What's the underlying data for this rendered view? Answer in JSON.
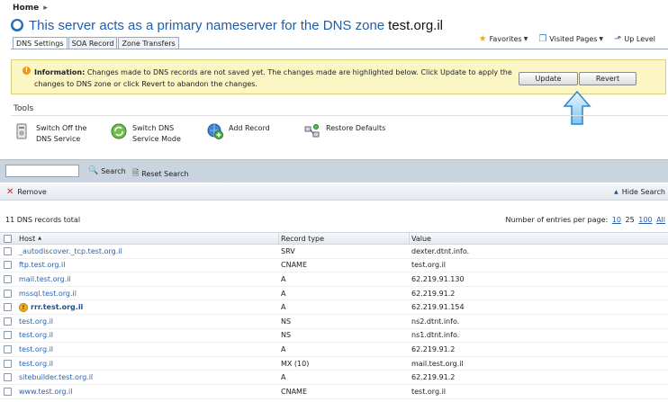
{
  "breadcrumb": {
    "home": "Home",
    "sep": "▸"
  },
  "title": {
    "text": "This server acts as a primary nameserver for the DNS zone",
    "zone": "test.org.il"
  },
  "tabs": [
    {
      "label": "DNS Settings",
      "active": true
    },
    {
      "label": "SOA Record",
      "active": false
    },
    {
      "label": "Zone Transfers",
      "active": false
    }
  ],
  "toplinks": {
    "favorites": "Favorites",
    "visited": "Visited Pages",
    "uplevel": "Up Level"
  },
  "info": {
    "label": "Information:",
    "message": "Changes made to DNS records are not saved yet. The changes made are highlighted below. Click Update to apply the changes to DNS zone or click Revert to abandon the changes.",
    "update_label": "Update",
    "revert_label": "Revert"
  },
  "tools": {
    "label": "Tools",
    "switch_off": [
      "Switch Off the",
      "DNS Service"
    ],
    "switch_mode": [
      "Switch DNS",
      "Service Mode"
    ],
    "add_record": "Add Record",
    "restore": "Restore Defaults"
  },
  "search": {
    "value": "",
    "search_label": "Search",
    "reset_label": "Reset Search"
  },
  "actions": {
    "remove_label": "Remove",
    "hide_search_label": "Hide Search"
  },
  "list": {
    "count_text": "11 DNS records total",
    "per_page_label": "Number of entries per page:",
    "per_page_options": [
      "10",
      "25",
      "100",
      "All"
    ]
  },
  "table": {
    "columns": {
      "host": "Host",
      "type": "Record type",
      "value": "Value"
    },
    "rows": [
      {
        "host": "_autodiscover._tcp.test.org.il",
        "type": "SRV",
        "value": "dexter.dtnt.info.",
        "warn": false
      },
      {
        "host": "ftp.test.org.il",
        "type": "CNAME",
        "value": "test.org.il",
        "warn": false
      },
      {
        "host": "mail.test.org.il",
        "type": "A",
        "value": "62.219.91.130",
        "warn": false
      },
      {
        "host": "mssql.test.org.il",
        "type": "A",
        "value": "62.219.91.2",
        "warn": false
      },
      {
        "host": "rrr.test.org.il",
        "type": "A",
        "value": "62.219.91.154",
        "warn": true
      },
      {
        "host": "test.org.il",
        "type": "NS",
        "value": "ns2.dtnt.info.",
        "warn": false
      },
      {
        "host": "test.org.il",
        "type": "NS",
        "value": "ns1.dtnt.info.",
        "warn": false
      },
      {
        "host": "test.org.il",
        "type": "A",
        "value": "62.219.91.2",
        "warn": false
      },
      {
        "host": "test.org.il",
        "type": "MX (10)",
        "value": "mail.test.org.il",
        "warn": false
      },
      {
        "host": "sitebuilder.test.org.il",
        "type": "A",
        "value": "62.219.91.2",
        "warn": false
      },
      {
        "host": "www.test.org.il",
        "type": "CNAME",
        "value": "test.org.il",
        "warn": false
      }
    ]
  }
}
